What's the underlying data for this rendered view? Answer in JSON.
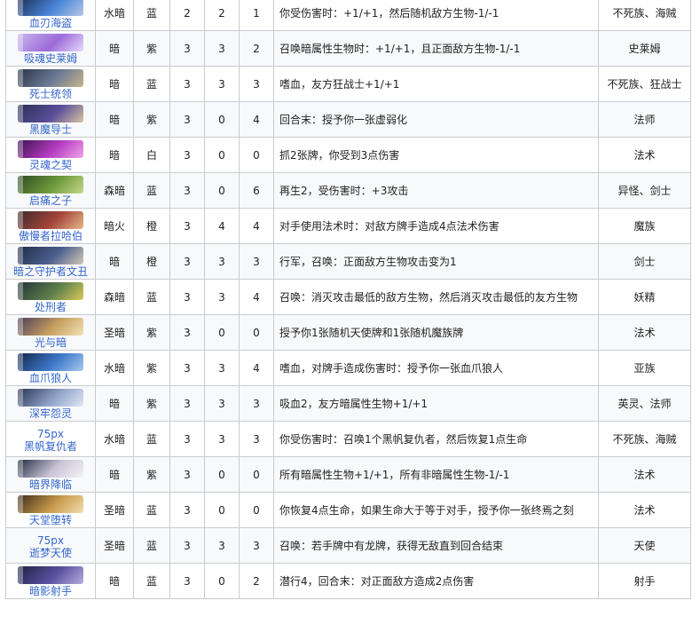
{
  "rows": [
    {
      "name": "血刃海盗",
      "thumb": {
        "type": "image",
        "colors": [
          "#1a2b55",
          "#4a86d8",
          "#b6c8e6"
        ]
      },
      "element": "水暗",
      "color": "蓝",
      "c1": "2",
      "c2": "2",
      "c3": "1",
      "effect": "你受伤害时：+1/+1，然后随机敌方生物-1/-1",
      "race": "不死族、海贼"
    },
    {
      "name": "吸魂史莱姆",
      "thumb": {
        "type": "image",
        "colors": [
          "#c9b6ee",
          "#9b6ad8",
          "#e8dcff"
        ]
      },
      "element": "暗",
      "color": "紫",
      "c1": "3",
      "c2": "3",
      "c3": "2",
      "effect": "召唤暗属性生物时：+1/+1，且正面敌方生物-1/-1",
      "race": "史莱姆"
    },
    {
      "name": "死士统领",
      "thumb": {
        "type": "image",
        "colors": [
          "#2a3344",
          "#6b7a96",
          "#c9b48a"
        ]
      },
      "element": "暗",
      "color": "蓝",
      "c1": "3",
      "c2": "3",
      "c3": "3",
      "effect": "嗜血，友方狂战士+1/+1",
      "race": "不死族、狂战士"
    },
    {
      "name": "黑魔导士",
      "thumb": {
        "type": "image",
        "colors": [
          "#2b2f55",
          "#5a4e9a",
          "#d7c3a0"
        ]
      },
      "element": "暗",
      "color": "紫",
      "c1": "3",
      "c2": "0",
      "c3": "4",
      "effect": "回合末：授予你一张虚弱化",
      "race": "法师"
    },
    {
      "name": "灵魂之契",
      "thumb": {
        "type": "image",
        "colors": [
          "#3b1150",
          "#b53cc0",
          "#f1a4e8"
        ]
      },
      "element": "暗",
      "color": "白",
      "c1": "3",
      "c2": "0",
      "c3": "0",
      "effect": "抓2张牌，你受到3点伤害",
      "race": "法术"
    },
    {
      "name": "启痛之子",
      "thumb": {
        "type": "image",
        "colors": [
          "#2f4a24",
          "#6e9a3c",
          "#c7d98c"
        ]
      },
      "element": "森暗",
      "color": "蓝",
      "c1": "3",
      "c2": "0",
      "c3": "6",
      "effect": "再生2，受伤害时：+3攻击",
      "race": "异怪、剑士"
    },
    {
      "name": "傲慢者拉哈伯",
      "thumb": {
        "type": "image",
        "colors": [
          "#3a2a2a",
          "#a5443a",
          "#e6b98c"
        ]
      },
      "element": "暗火",
      "color": "橙",
      "c1": "3",
      "c2": "4",
      "c3": "4",
      "effect": "对手使用法术时：对敌方牌手造成4点法术伤害",
      "race": "魔族"
    },
    {
      "name": "暗之守护者文丑",
      "thumb": {
        "type": "image",
        "colors": [
          "#1f2a44",
          "#4b5f8e",
          "#d2c9b6"
        ]
      },
      "element": "暗",
      "color": "橙",
      "c1": "3",
      "c2": "3",
      "c3": "3",
      "effect": "行军，召唤：正面敌方生物攻击变为1",
      "race": "剑士"
    },
    {
      "name": "处刑者",
      "thumb": {
        "type": "image",
        "colors": [
          "#23313b",
          "#5c7f4a",
          "#d9c95a"
        ]
      },
      "element": "森暗",
      "color": "蓝",
      "c1": "3",
      "c2": "3",
      "c3": "4",
      "effect": "召唤：消灭攻击最低的敌方生物，然后消灭攻击最低的友方生物",
      "race": "妖精"
    },
    {
      "name": "光与暗",
      "thumb": {
        "type": "image",
        "colors": [
          "#4a3a5a",
          "#c8a060",
          "#f2e2b8"
        ]
      },
      "element": "圣暗",
      "color": "紫",
      "c1": "3",
      "c2": "0",
      "c3": "0",
      "effect": "授予你1张随机天使牌和1张随机魔族牌",
      "race": "法术"
    },
    {
      "name": "血爪狼人",
      "thumb": {
        "type": "image",
        "colors": [
          "#14254a",
          "#3d78c8",
          "#a8c8ee"
        ]
      },
      "element": "水暗",
      "color": "紫",
      "c1": "3",
      "c2": "3",
      "c3": "4",
      "effect": "嗜血，对牌手造成伤害时：授予你一张血爪狼人",
      "race": "亚族"
    },
    {
      "name": "深牢怨灵",
      "thumb": {
        "type": "image",
        "colors": [
          "#2a3552",
          "#8fa2c8",
          "#e2e8f4"
        ]
      },
      "element": "暗",
      "color": "紫",
      "c1": "3",
      "c2": "3",
      "c3": "3",
      "effect": "吸血2，友方暗属性生物+1/+1",
      "race": "英灵、法师"
    },
    {
      "name": "黑帆复仇者",
      "thumb": {
        "type": "placeholder",
        "label": "75px"
      },
      "element": "水暗",
      "color": "蓝",
      "c1": "3",
      "c2": "3",
      "c3": "3",
      "effect": "你受伤害时：召唤1个黑帆复仇者，然后恢复1点生命",
      "race": "不死族、海贼"
    },
    {
      "name": "暗界降临",
      "thumb": {
        "type": "image",
        "colors": [
          "#202a40",
          "#c9c4d6",
          "#f4f2f8"
        ]
      },
      "element": "暗",
      "color": "紫",
      "c1": "3",
      "c2": "0",
      "c3": "0",
      "effect": "所有暗属性生物+1/+1，所有非暗属性生物-1/-1",
      "race": "法术"
    },
    {
      "name": "天堂堕转",
      "thumb": {
        "type": "image",
        "colors": [
          "#3a2b1c",
          "#c89a4a",
          "#f2dfae"
        ]
      },
      "element": "圣暗",
      "color": "蓝",
      "c1": "3",
      "c2": "0",
      "c3": "0",
      "effect": "你恢复4点生命，如果生命大于等于对手，授予你一张终焉之刻",
      "race": "法术"
    },
    {
      "name": "逝梦天使",
      "thumb": {
        "type": "placeholder",
        "label": "75px"
      },
      "element": "圣暗",
      "color": "蓝",
      "c1": "3",
      "c2": "3",
      "c3": "3",
      "effect": "召唤：若手牌中有龙牌，获得无敌直到回合结束",
      "race": "天使"
    },
    {
      "name": "暗影射手",
      "thumb": {
        "type": "image",
        "colors": [
          "#1c2240",
          "#5a4fa0",
          "#b7aee0"
        ]
      },
      "element": "暗",
      "color": "蓝",
      "c1": "3",
      "c2": "0",
      "c3": "2",
      "effect": "潜行4，回合末：对正面敌方造成2点伤害",
      "race": "射手"
    }
  ]
}
